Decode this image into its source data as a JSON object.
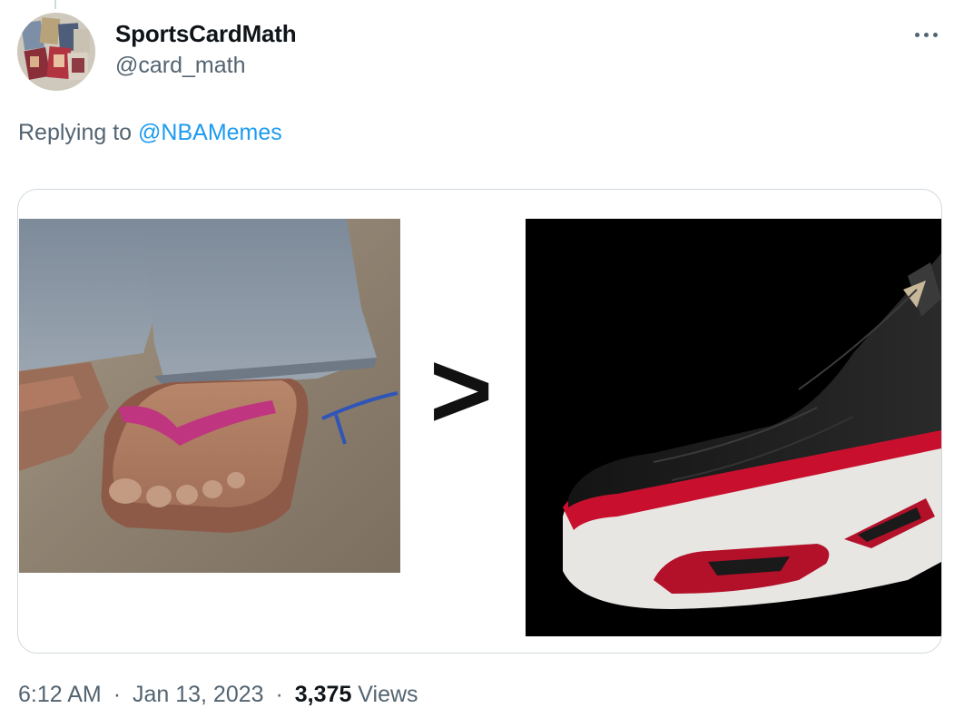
{
  "tweet": {
    "author": {
      "display_name": "SportsCardMath",
      "handle": "@card_math"
    },
    "reply_prefix": "Replying to",
    "reply_to": "@NBAMemes",
    "media": {
      "comparison_symbol": ">",
      "left_image": "photo-feet-in-worn-sandals",
      "right_image": "photo-black-red-white-sneaker"
    },
    "time": "6:12 AM",
    "date": "Jan 13, 2023",
    "separator": "·",
    "views_count": "3,375",
    "views_label": "Views"
  },
  "icons": {
    "more": "more-options-icon"
  },
  "colors": {
    "primary_text": "#0f1419",
    "secondary_text": "#536471",
    "link": "#1d9bf0",
    "border": "#cfd9de"
  }
}
